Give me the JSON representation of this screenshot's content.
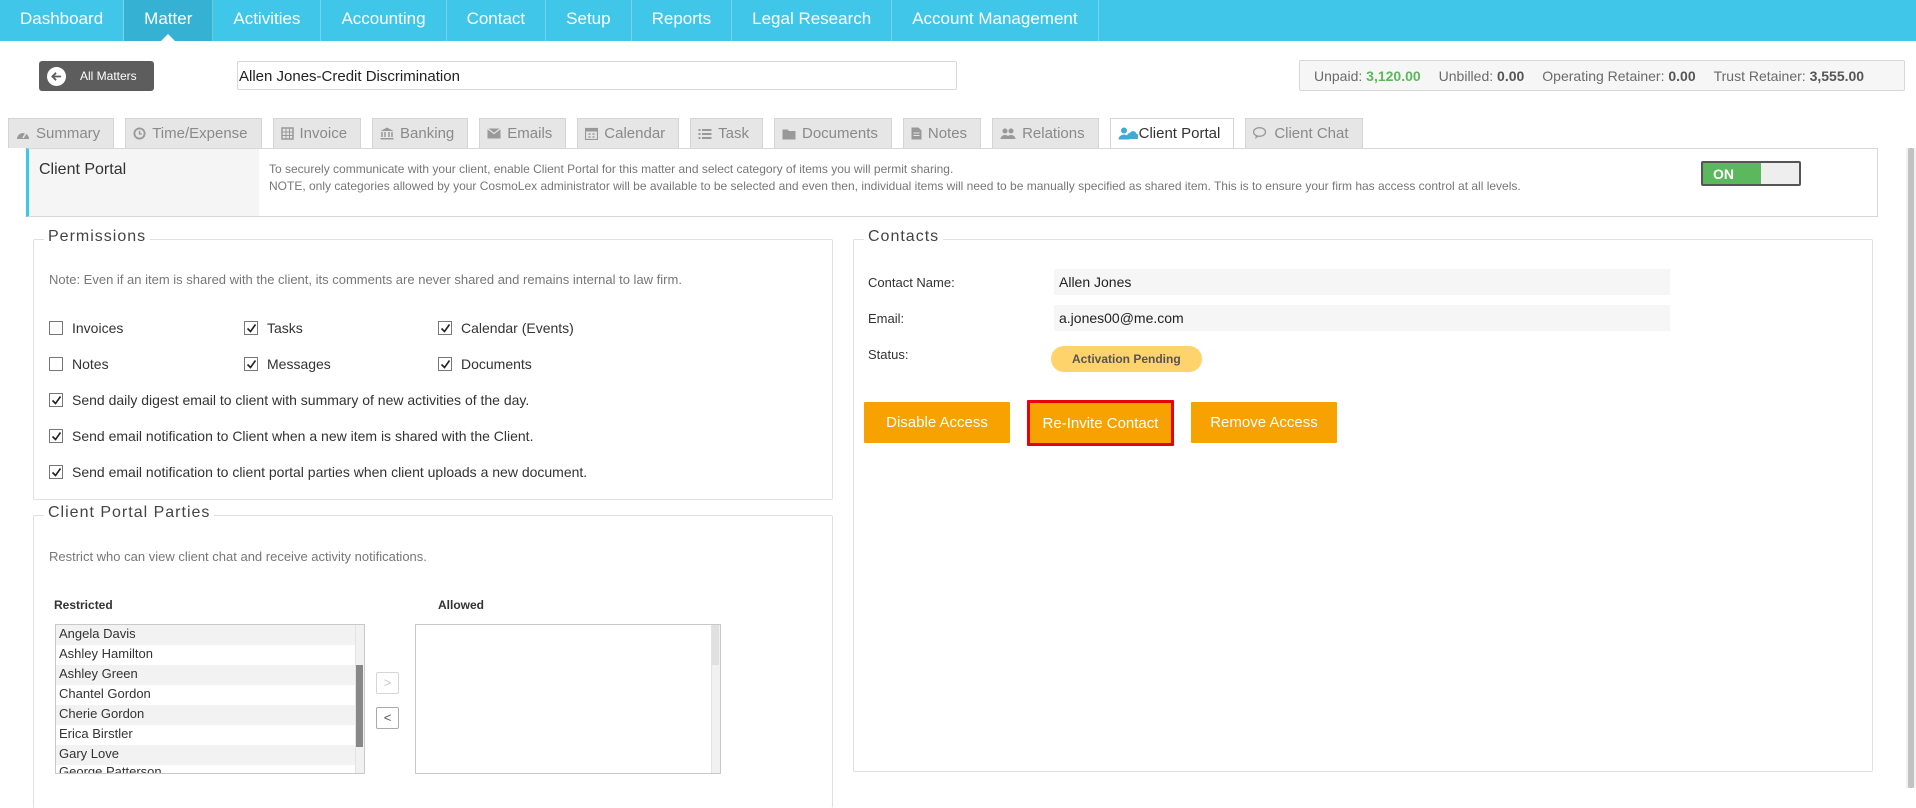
{
  "topnav": {
    "items": [
      "Dashboard",
      "Matter",
      "Activities",
      "Accounting",
      "Contact",
      "Setup",
      "Reports",
      "Legal Research",
      "Account Management"
    ],
    "active_index": 1
  },
  "header": {
    "all_matters_label": "All Matters",
    "matter_title": "Allen Jones-Credit Discrimination",
    "unpaid_label": "Unpaid:",
    "unpaid_value": "3,120.00",
    "unbilled_label": "Unbilled:",
    "unbilled_value": "0.00",
    "operating_label": "Operating Retainer:",
    "operating_value": "0.00",
    "trust_label": "Trust Retainer:",
    "trust_value": "3,555.00"
  },
  "tabs": [
    {
      "label": "Summary",
      "icon": "dashboard-icon"
    },
    {
      "label": "Time/Expense",
      "icon": "clock-icon"
    },
    {
      "label": "Invoice",
      "icon": "invoice-icon"
    },
    {
      "label": "Banking",
      "icon": "bank-icon"
    },
    {
      "label": "Emails",
      "icon": "envelope-icon"
    },
    {
      "label": "Calendar",
      "icon": "calendar-icon"
    },
    {
      "label": "Task",
      "icon": "task-list-icon"
    },
    {
      "label": "Documents",
      "icon": "folder-icon"
    },
    {
      "label": "Notes",
      "icon": "note-icon"
    },
    {
      "label": "Relations",
      "icon": "users-icon"
    },
    {
      "label": "Client Portal",
      "icon": "client-portal-icon"
    },
    {
      "label": "Client Chat",
      "icon": "chat-icon"
    }
  ],
  "active_tab": "Client Portal",
  "portal": {
    "title": "Client Portal",
    "desc_line1": "To securely communicate with your client, enable Client Portal for this matter and select category of items you will permit sharing.",
    "desc_line2": "NOTE, only categories allowed by your CosmoLex administrator will be available to be selected and even then, individual items will need to be manually specified as shared item. This is to ensure your firm has access control at all levels.",
    "toggle_label": "ON",
    "toggle_on": true
  },
  "permissions": {
    "legend": "Permissions",
    "note": "Note: Even if an item is shared with the client, its comments are never shared and remains internal to law firm.",
    "invoices": "Invoices",
    "tasks": "Tasks",
    "calendar": "Calendar (Events)",
    "notes": "Notes",
    "messages": "Messages",
    "documents": "Documents",
    "daily_digest": "Send daily digest email to client with summary of new activities of the day.",
    "notify_shared": "Send email notification to Client when a new item is shared with the Client.",
    "notify_upload": "Send email notification to client portal parties when client uploads a new document."
  },
  "parties": {
    "legend": "Client Portal Parties",
    "note": "Restrict who can view client chat and receive activity notifications.",
    "restricted_label": "Restricted",
    "allowed_label": "Allowed",
    "restricted": [
      "Angela Davis",
      "Ashley Hamilton",
      "Ashley Green",
      "Chantel Gordon",
      "Cherie Gordon",
      "Erica Birstler",
      "Gary Love",
      "George Patterson"
    ],
    "move_right": ">",
    "move_left": "<"
  },
  "contacts": {
    "legend": "Contacts",
    "name_label": "Contact Name:",
    "name_value": "Allen Jones",
    "email_label": "Email:",
    "email_value": "a.jones00@me.com",
    "status_label": "Status:",
    "status_value": "Activation Pending",
    "disable_btn": "Disable Access",
    "reinvite_btn": "Re-Invite Contact",
    "remove_btn": "Remove Access"
  },
  "colors": {
    "nav": "#3fc6e8",
    "accent_green": "#5cb85c",
    "button_orange": "#f7a200",
    "highlight_red": "#e8000b",
    "badge_yellow": "#ffd36b"
  }
}
